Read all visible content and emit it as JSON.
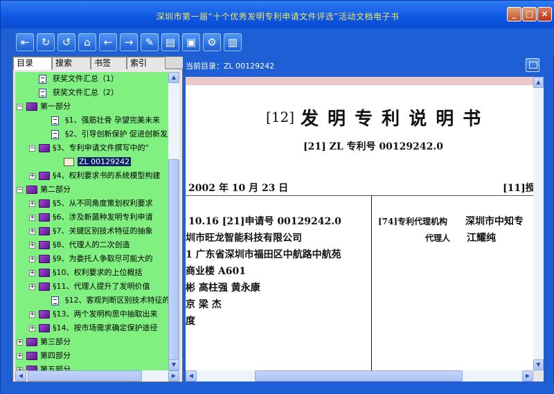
{
  "window": {
    "title": "深圳市第一届“十个优秀发明专利申请文件评选”活动文档电子书"
  },
  "window_controls": [
    "_",
    "□",
    "×"
  ],
  "toolbar": {
    "buttons": [
      {
        "name": "exit-icon",
        "glyph": "⇤"
      },
      {
        "name": "refresh-icon",
        "glyph": "↻"
      },
      {
        "name": "undo-icon",
        "glyph": "↺"
      },
      {
        "name": "home-icon",
        "glyph": "⌂"
      },
      {
        "name": "back-icon",
        "glyph": "←"
      },
      {
        "name": "forward-icon",
        "glyph": "→"
      },
      {
        "name": "tools-icon",
        "glyph": "✎"
      },
      {
        "name": "notes-icon",
        "glyph": "▤"
      },
      {
        "name": "image-icon",
        "glyph": "▣"
      },
      {
        "name": "settings-icon",
        "glyph": "⚙"
      },
      {
        "name": "bookmark-icon",
        "glyph": "▥"
      }
    ]
  },
  "tabs": [
    "目录",
    "搜索",
    "书签",
    "索引"
  ],
  "tree": [
    {
      "indent": 1,
      "icon": "doc",
      "expander": "",
      "label": "获奖文件汇总（1）"
    },
    {
      "indent": 1,
      "icon": "doc",
      "expander": "",
      "label": "获奖文件汇总（2）"
    },
    {
      "indent": 0,
      "icon": "book",
      "expander": "−",
      "label": "第一部分"
    },
    {
      "indent": 2,
      "icon": "doc",
      "expander": "",
      "label": "§1、强筋壮骨 孕望完美未来"
    },
    {
      "indent": 2,
      "icon": "doc",
      "expander": "",
      "label": "§2、引导创新保护 促进创新发展"
    },
    {
      "indent": 1,
      "icon": "book",
      "expander": "−",
      "label": "§3、专利申请文件撰写中的“"
    },
    {
      "indent": 3,
      "icon": "open",
      "expander": "",
      "label": "ZL 00129242",
      "selected": true
    },
    {
      "indent": 1,
      "icon": "book",
      "expander": "+",
      "label": "§4、权利要求书的系统模型构建"
    },
    {
      "indent": 0,
      "icon": "book",
      "expander": "−",
      "label": "第二部分"
    },
    {
      "indent": 1,
      "icon": "book",
      "expander": "+",
      "label": "§5、从不同角度策划权利要求"
    },
    {
      "indent": 1,
      "icon": "book",
      "expander": "+",
      "label": "§6、涉及新菌种发明专利申请"
    },
    {
      "indent": 1,
      "icon": "book",
      "expander": "+",
      "label": "§7、关键区别技术特征的抽象"
    },
    {
      "indent": 1,
      "icon": "book",
      "expander": "+",
      "label": "§8、代理人的二次创造"
    },
    {
      "indent": 1,
      "icon": "book",
      "expander": "+",
      "label": "§9、为委托人争取尽可能大的"
    },
    {
      "indent": 1,
      "icon": "book",
      "expander": "+",
      "label": "§10、权利要求的上位概括"
    },
    {
      "indent": 1,
      "icon": "book",
      "expander": "+",
      "label": "§11、代理人提升了发明价值"
    },
    {
      "indent": 2,
      "icon": "doc",
      "expander": "",
      "label": "§12、客观判断区别技术特征的"
    },
    {
      "indent": 1,
      "icon": "book",
      "expander": "+",
      "label": "§13、两个发明构思中抽取出来"
    },
    {
      "indent": 1,
      "icon": "book",
      "expander": "+",
      "label": "§14、按市场需求确定保护途径"
    },
    {
      "indent": 0,
      "icon": "book",
      "expander": "+",
      "label": "第三部分"
    },
    {
      "indent": 0,
      "icon": "book",
      "expander": "+",
      "label": "第四部分"
    },
    {
      "indent": 0,
      "icon": "book",
      "expander": "+",
      "label": "第五部分"
    }
  ],
  "right": {
    "current_dir_label": "当前目录：ZL 00129242"
  },
  "document": {
    "l1": "[12]",
    "l1b": "发 明 专 利 说 明 书",
    "l2": "[21] ZL 专利号   00129242.0",
    "l3": "2002 年 10 月 23 日",
    "l3r": "[11]授",
    "c1": "10.16   [21]申请号   00129242.0",
    "c2": "圳市旺龙智能科技有限公司",
    "c3": "1 广东省深圳市福田区中航路中航苑",
    "c4": "商业楼 A601",
    "c5": "彬   高柱强   黄永康",
    "c6": "京   梁   杰",
    "c7": "度",
    "r1a": "[74]专利代理机构",
    "r1b": "深圳市中知专",
    "r2a": "代理人",
    "r2b": "江耀纯"
  },
  "scroll": {
    "up": "▲",
    "down": "▼",
    "left": "◀",
    "right": "▶"
  }
}
